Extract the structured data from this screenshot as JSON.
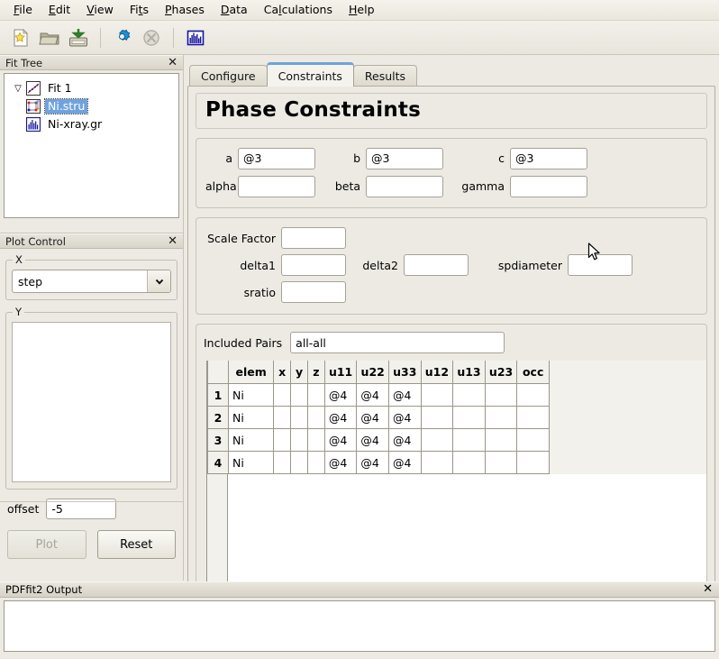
{
  "app": {
    "title": "PDFgui",
    "accent_color": "#6ea2dd",
    "panel_bg": "#eceae3",
    "selection_color": "#6fa3df"
  },
  "menubar": {
    "items": [
      {
        "label": "File",
        "accel": "F"
      },
      {
        "label": "Edit",
        "accel": "E"
      },
      {
        "label": "View",
        "accel": "V"
      },
      {
        "label": "Fits",
        "accel": "t"
      },
      {
        "label": "Phases",
        "accel": "P"
      },
      {
        "label": "Data",
        "accel": "D"
      },
      {
        "label": "Calculations",
        "accel": "l"
      },
      {
        "label": "Help",
        "accel": "H"
      }
    ]
  },
  "toolbar": {
    "buttons": [
      {
        "name": "new-fit-icon",
        "tooltip": "New Fit"
      },
      {
        "name": "open-folder-icon",
        "tooltip": "Open"
      },
      {
        "name": "save-disk-icon",
        "tooltip": "Save"
      },
      {
        "name": "run-gear-icon",
        "tooltip": "Run Fit"
      },
      {
        "name": "stop-icon",
        "tooltip": "Stop",
        "disabled": true
      },
      {
        "name": "plot-chart-icon",
        "tooltip": "Plot"
      }
    ]
  },
  "fit_tree": {
    "title": "Fit Tree",
    "close_label": "✕",
    "nodes": [
      {
        "label": "Fit 1",
        "icon": "fit-icon",
        "expanded": true,
        "expander": "▽",
        "selected": false
      },
      {
        "label": "Ni.stru",
        "icon": "structure-icon",
        "selected": true
      },
      {
        "label": "Ni-xray.gr",
        "icon": "dataset-icon",
        "selected": false
      }
    ]
  },
  "plot_control": {
    "title": "Plot Control",
    "close_label": "✕",
    "x_group_label": "X",
    "x_value": "step",
    "y_group_label": "Y",
    "y_items": [],
    "offset_label": "offset",
    "offset_value": "-5",
    "plot_button": "Plot",
    "plot_button_disabled": true,
    "reset_button": "Reset"
  },
  "tabs": [
    {
      "label": "Configure",
      "active": false
    },
    {
      "label": "Constraints",
      "active": true
    },
    {
      "label": "Results",
      "active": false
    }
  ],
  "constraints_page": {
    "heading": "Phase Constraints",
    "lattice": {
      "fields": [
        {
          "label": "a",
          "value": "@3"
        },
        {
          "label": "b",
          "value": "@3"
        },
        {
          "label": "c",
          "value": "@3"
        },
        {
          "label": "alpha",
          "value": ""
        },
        {
          "label": "beta",
          "value": ""
        },
        {
          "label": "gamma",
          "value": ""
        }
      ]
    },
    "scale": {
      "scale_factor_label": "Scale Factor",
      "scale_factor_value": "",
      "delta1_label": "delta1",
      "delta1_value": "",
      "delta2_label": "delta2",
      "delta2_value": "",
      "spdiameter_label": "spdiameter",
      "spdiameter_value": "",
      "sratio_label": "sratio",
      "sratio_value": ""
    },
    "included_pairs_label": "Included Pairs",
    "included_pairs_value": "all-all",
    "table": {
      "columns": [
        "elem",
        "x",
        "y",
        "z",
        "u11",
        "u22",
        "u33",
        "u12",
        "u13",
        "u23",
        "occ"
      ],
      "rows": [
        {
          "n": "1",
          "cells": [
            "Ni",
            "",
            "",
            "",
            "@4",
            "@4",
            "@4",
            "",
            "",
            "",
            ""
          ]
        },
        {
          "n": "2",
          "cells": [
            "Ni",
            "",
            "",
            "",
            "@4",
            "@4",
            "@4",
            "",
            "",
            "",
            ""
          ]
        },
        {
          "n": "3",
          "cells": [
            "Ni",
            "",
            "",
            "",
            "@4",
            "@4",
            "@4",
            "",
            "",
            "",
            ""
          ]
        },
        {
          "n": "4",
          "cells": [
            "Ni",
            "",
            "",
            "",
            "@4",
            "@4",
            "@4",
            "",
            "",
            "",
            ""
          ]
        }
      ]
    }
  },
  "output_dock": {
    "title": "PDFfit2 Output",
    "close_label": "✕",
    "content": ""
  }
}
